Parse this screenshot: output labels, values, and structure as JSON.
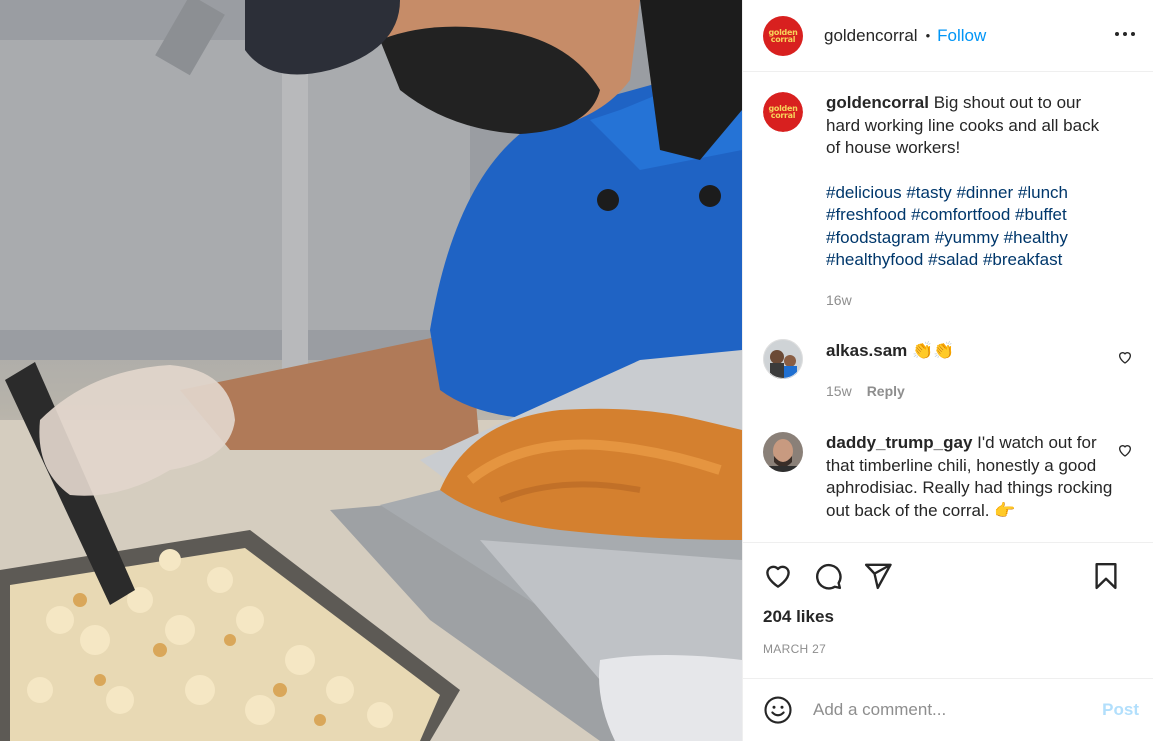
{
  "post": {
    "author": "goldencorral",
    "logo_text": [
      "golden",
      "corral"
    ],
    "follow_label": "Follow",
    "separator": "•",
    "caption": "Big shout out to our hard working line cooks and all back of house workers!",
    "hashtags": [
      "#delicious",
      "#tasty",
      "#dinner",
      "#lunch",
      "#freshfood",
      "#comfortfood",
      "#buffet",
      "#foodstagram",
      "#yummy",
      "#healthy",
      "#healthyfood",
      "#salad",
      "#breakfast"
    ],
    "age": "16w",
    "likes": "204 likes",
    "date": "MARCH 27"
  },
  "comments": [
    {
      "user": "alkas.sam",
      "text": "👏👏",
      "age": "15w",
      "reply_label": "Reply"
    },
    {
      "user": "daddy_trump_gay",
      "text": "I'd watch out for that timberline chili, honestly a good aphrodisiac. Really had things rocking out back of the corral. 👉"
    }
  ],
  "add_comment": {
    "placeholder": "Add a comment...",
    "post_label": "Post"
  },
  "icons": [
    "more-icon",
    "heart-icon",
    "comment-icon",
    "share-icon",
    "bookmark-icon",
    "emoji-icon"
  ],
  "colors": {
    "accent": "#0095f6",
    "post_disabled": "#b2dffc",
    "brand_red": "#d8201f",
    "brand_yellow": "#f7d25a"
  }
}
